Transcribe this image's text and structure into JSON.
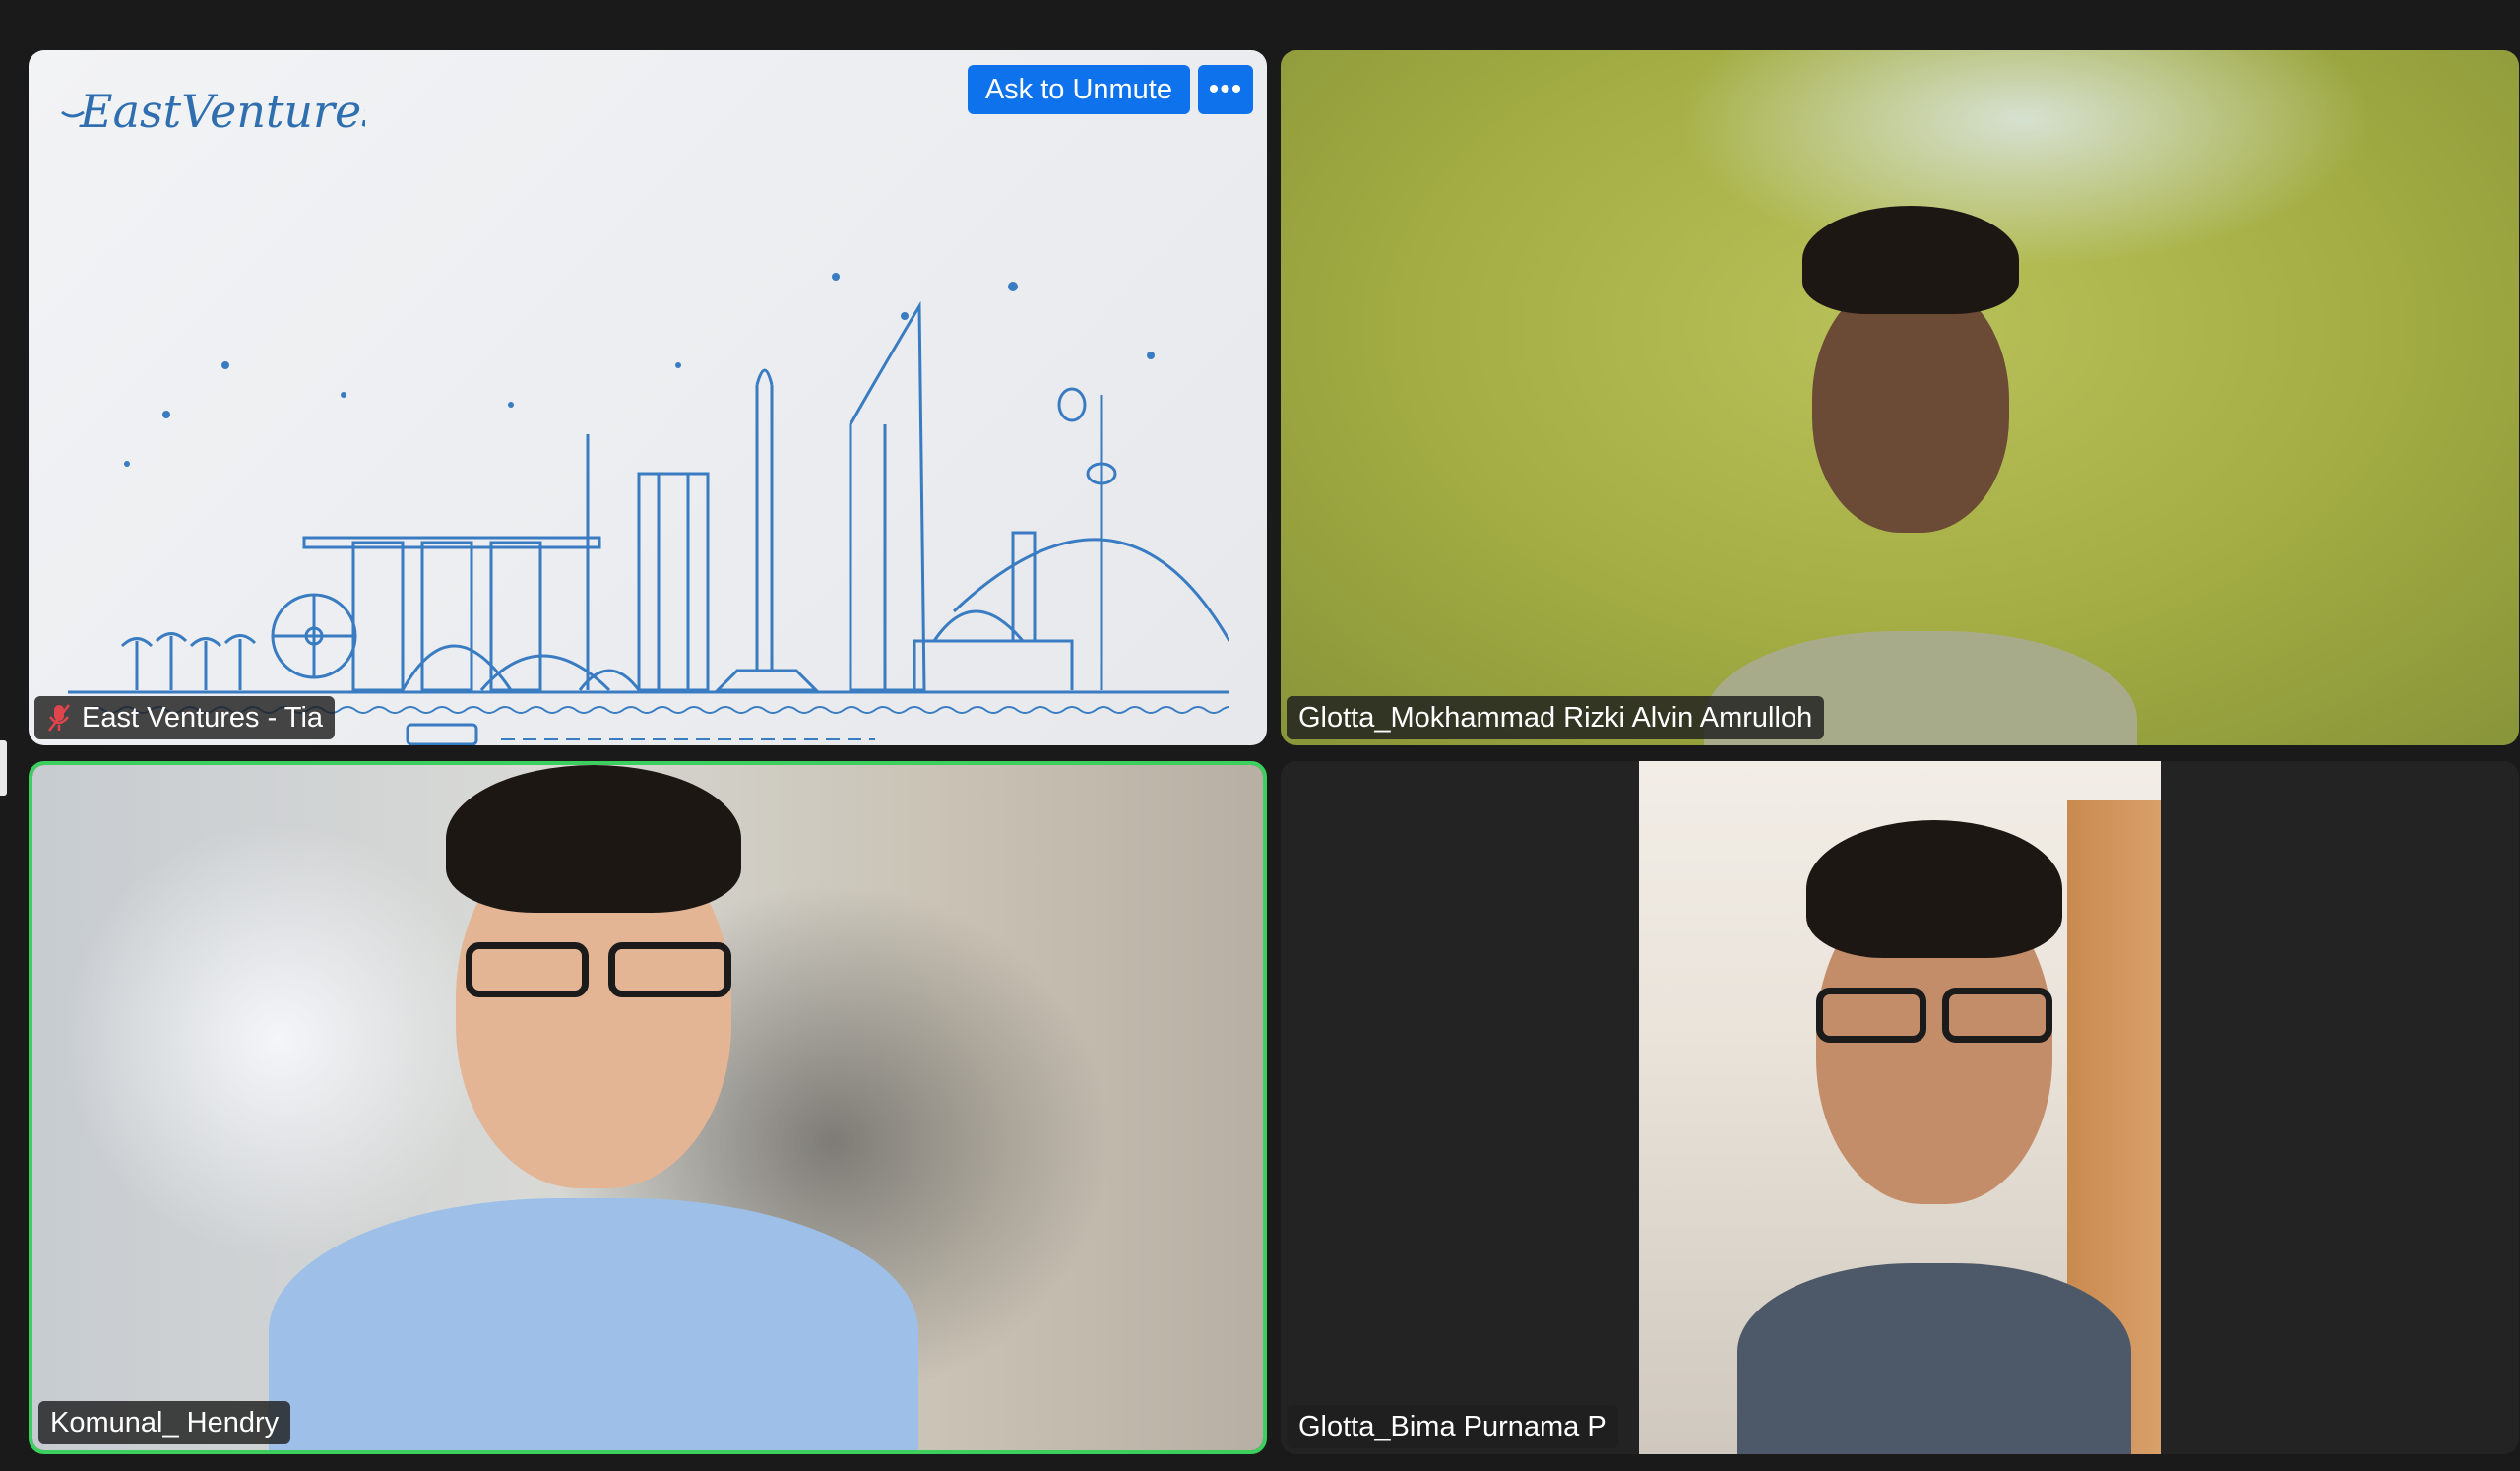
{
  "participants": [
    {
      "id": "ev",
      "name": "East Ventures - Tia",
      "muted": true,
      "ask_to_unmute_label": "Ask to Unmute",
      "more_label": "•••",
      "logo_text": "EastVentures"
    },
    {
      "id": "rizki",
      "name": "Glotta_Mokhammad Rizki Alvin Amrulloh"
    },
    {
      "id": "hendry",
      "name": "Komunal_ Hendry",
      "active_speaker": true
    },
    {
      "id": "bima",
      "name": "Glotta_Bima Purnama P"
    }
  ],
  "colors": {
    "active_speaker_border": "#3ccf5e",
    "unmute_button": "#0e72ed",
    "logo": "#2f6fb0",
    "muted_icon": "#e0454b"
  }
}
